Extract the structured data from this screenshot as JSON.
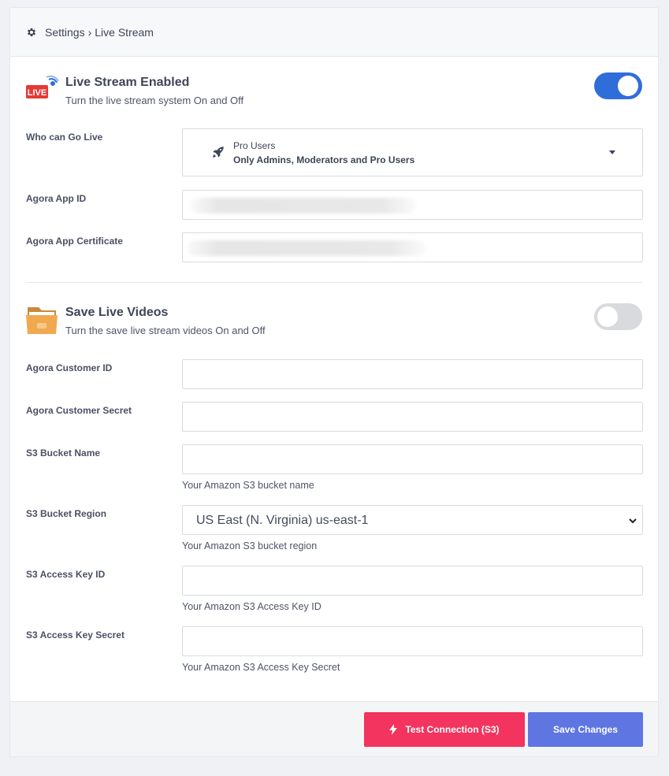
{
  "breadcrumb": {
    "icon": "gear-icon",
    "parent": "Settings",
    "separator": "›",
    "current": "Live Stream"
  },
  "live_stream": {
    "icon": "live-broadcast-icon",
    "title": "Live Stream Enabled",
    "description": "Turn the live stream system On and Off",
    "enabled": true
  },
  "who_can_go_live": {
    "label": "Who can Go Live",
    "icon": "rocket-icon",
    "selected_title": "Pro Users",
    "selected_subtitle": "Only Admins, Moderators and Pro Users"
  },
  "agora_app_id": {
    "label": "Agora App ID",
    "value": ""
  },
  "agora_app_certificate": {
    "label": "Agora App Certificate",
    "value": ""
  },
  "save_videos": {
    "icon": "folder-icon",
    "title": "Save Live Videos",
    "description": "Turn the save live stream videos On and Off",
    "enabled": false
  },
  "agora_customer_id": {
    "label": "Agora Customer ID",
    "value": ""
  },
  "agora_customer_secret": {
    "label": "Agora Customer Secret",
    "value": ""
  },
  "s3_bucket_name": {
    "label": "S3 Bucket Name",
    "value": "",
    "hint": "Your Amazon S3 bucket name"
  },
  "s3_bucket_region": {
    "label": "S3 Bucket Region",
    "selected": "US East (N. Virginia) us-east-1",
    "hint": "Your Amazon S3 bucket region"
  },
  "s3_access_key_id": {
    "label": "S3 Access Key ID",
    "value": "",
    "hint": "Your Amazon S3 Access Key ID"
  },
  "s3_access_key_secret": {
    "label": "S3 Access Key Secret",
    "value": "",
    "hint": "Your Amazon S3 Access Key Secret"
  },
  "footer": {
    "test_button": "Test Connection (S3)",
    "save_button": "Save Changes"
  },
  "colors": {
    "toggle_on": "#2f6ed9",
    "toggle_off": "#d9dadd",
    "test_button": "#f2345e",
    "save_button": "#5f75e2",
    "live_badge": "#e53935"
  }
}
